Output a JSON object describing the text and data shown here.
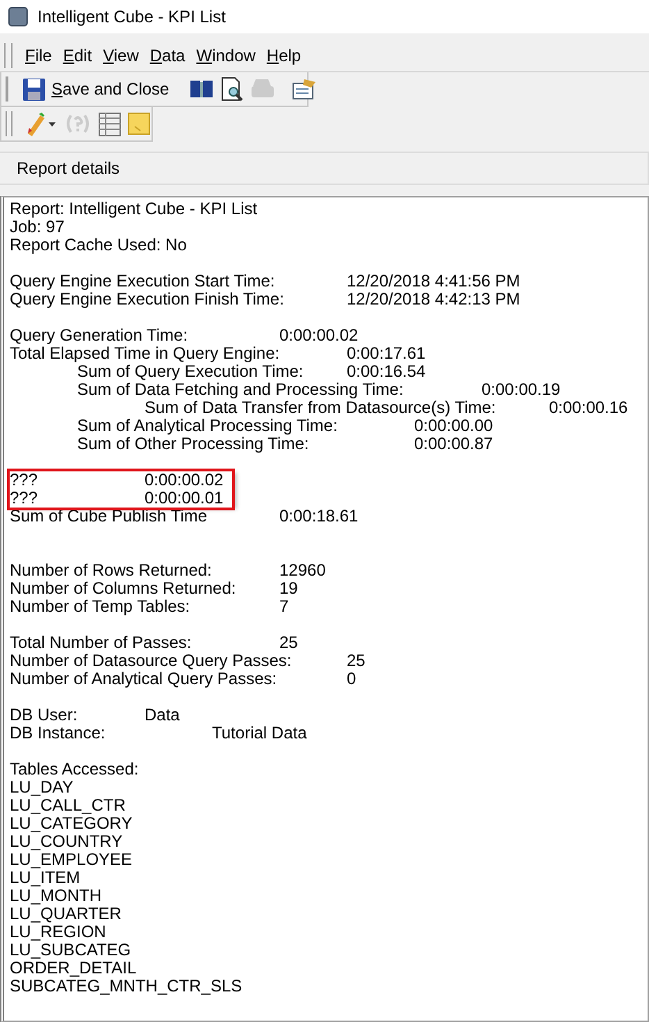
{
  "window": {
    "title": "Intelligent Cube - KPI List"
  },
  "menu": [
    {
      "label": "File"
    },
    {
      "label": "Edit"
    },
    {
      "label": "View"
    },
    {
      "label": "Data"
    },
    {
      "label": "Window"
    },
    {
      "label": "Help"
    }
  ],
  "toolbar": {
    "save_label": "Save and Close",
    "buttons": [
      {
        "kind": "book",
        "disabled": false
      },
      {
        "kind": "preview",
        "disabled": false
      },
      {
        "kind": "printer",
        "disabled": true
      },
      {
        "kind": "properties",
        "disabled": false
      }
    ]
  },
  "toolbar2": {
    "buttons": [
      {
        "kind": "pencil",
        "disabled": false
      },
      {
        "kind": "help",
        "disabled": true
      },
      {
        "kind": "grid",
        "disabled": false
      },
      {
        "kind": "note",
        "disabled": false
      }
    ]
  },
  "panel_header": "Report details",
  "report": {
    "sections": [
      [
        {
          "kind": "text",
          "text": "Report: Intelligent Cube - KPI List"
        },
        {
          "kind": "text",
          "text": "Job: 97"
        },
        {
          "kind": "text",
          "text": "Report Cache Used: No"
        }
      ],
      [
        {
          "kind": "pair",
          "label": "Query Engine Execution Start Time:",
          "value": "12/20/2018 4:41:56 PM"
        },
        {
          "kind": "pair",
          "label": "Query Engine Execution Finish Time:",
          "value": "12/20/2018 4:42:13 PM"
        }
      ],
      [
        {
          "kind": "pair",
          "label": "Query Generation Time:",
          "value": "0:00:00.02"
        },
        {
          "kind": "pair",
          "label": "Total Elapsed Time in Query Engine:",
          "value": "0:00:17.61",
          "children": [
            {
              "kind": "pair",
              "label": "Sum of Query Execution Time:",
              "value": "0:00:16.54"
            },
            {
              "kind": "pair",
              "label": "Sum of Data Fetching and Processing Time:",
              "value": "0:00:00.19",
              "children": [
                {
                  "kind": "pair",
                  "label": "Sum of Data Transfer from Datasource(s) Time:",
                  "value": "0:00:00.16"
                }
              ]
            },
            {
              "kind": "pair",
              "label": "Sum of Analytical Processing Time:",
              "value": "0:00:00.00"
            },
            {
              "kind": "pair",
              "label": "Sum of Other Processing Time:",
              "value": "0:00:00.87"
            }
          ]
        }
      ],
      [
        {
          "kind": "pair",
          "label": "???",
          "value": "0:00:00.02",
          "highlighted": true
        },
        {
          "kind": "pair",
          "label": "???",
          "value": "0:00:00.01",
          "highlighted": true
        },
        {
          "kind": "pair",
          "label": "Sum of Cube Publish Time",
          "value": "0:00:18.61",
          "highlighted": false
        }
      ],
      [
        {
          "kind": "pair",
          "label": "Number of Rows Returned:",
          "value": "12960"
        },
        {
          "kind": "pair",
          "label": "Number of Columns Returned:",
          "value": "19"
        },
        {
          "kind": "pair",
          "label": "Number of Temp Tables:",
          "value": "7"
        }
      ],
      [
        {
          "kind": "pair",
          "label": "Total Number of Passes:",
          "value": "25"
        },
        {
          "kind": "pair",
          "label": "Number of Datasource Query Passes:",
          "value": "25"
        },
        {
          "kind": "pair",
          "label": "Number of Analytical Query Passes:",
          "value": "0"
        }
      ],
      [
        {
          "kind": "pair",
          "label": "DB User:",
          "value": "Data"
        },
        {
          "kind": "pair",
          "label": "DB Instance:",
          "value": "Tutorial Data"
        }
      ],
      [
        {
          "kind": "text",
          "text": "Tables Accessed:"
        },
        {
          "kind": "text",
          "text": "LU_DAY"
        },
        {
          "kind": "text",
          "text": "LU_CALL_CTR"
        },
        {
          "kind": "text",
          "text": "LU_CATEGORY"
        },
        {
          "kind": "text",
          "text": "LU_COUNTRY"
        },
        {
          "kind": "text",
          "text": "LU_EMPLOYEE"
        },
        {
          "kind": "text",
          "text": "LU_ITEM"
        },
        {
          "kind": "text",
          "text": "LU_MONTH"
        },
        {
          "kind": "text",
          "text": "LU_QUARTER"
        },
        {
          "kind": "text",
          "text": "LU_REGION"
        },
        {
          "kind": "text",
          "text": "LU_SUBCATEG"
        },
        {
          "kind": "text",
          "text": "ORDER_DETAIL"
        },
        {
          "kind": "text",
          "text": "SUBCATEG_MNTH_CTR_SLS"
        }
      ]
    ]
  }
}
